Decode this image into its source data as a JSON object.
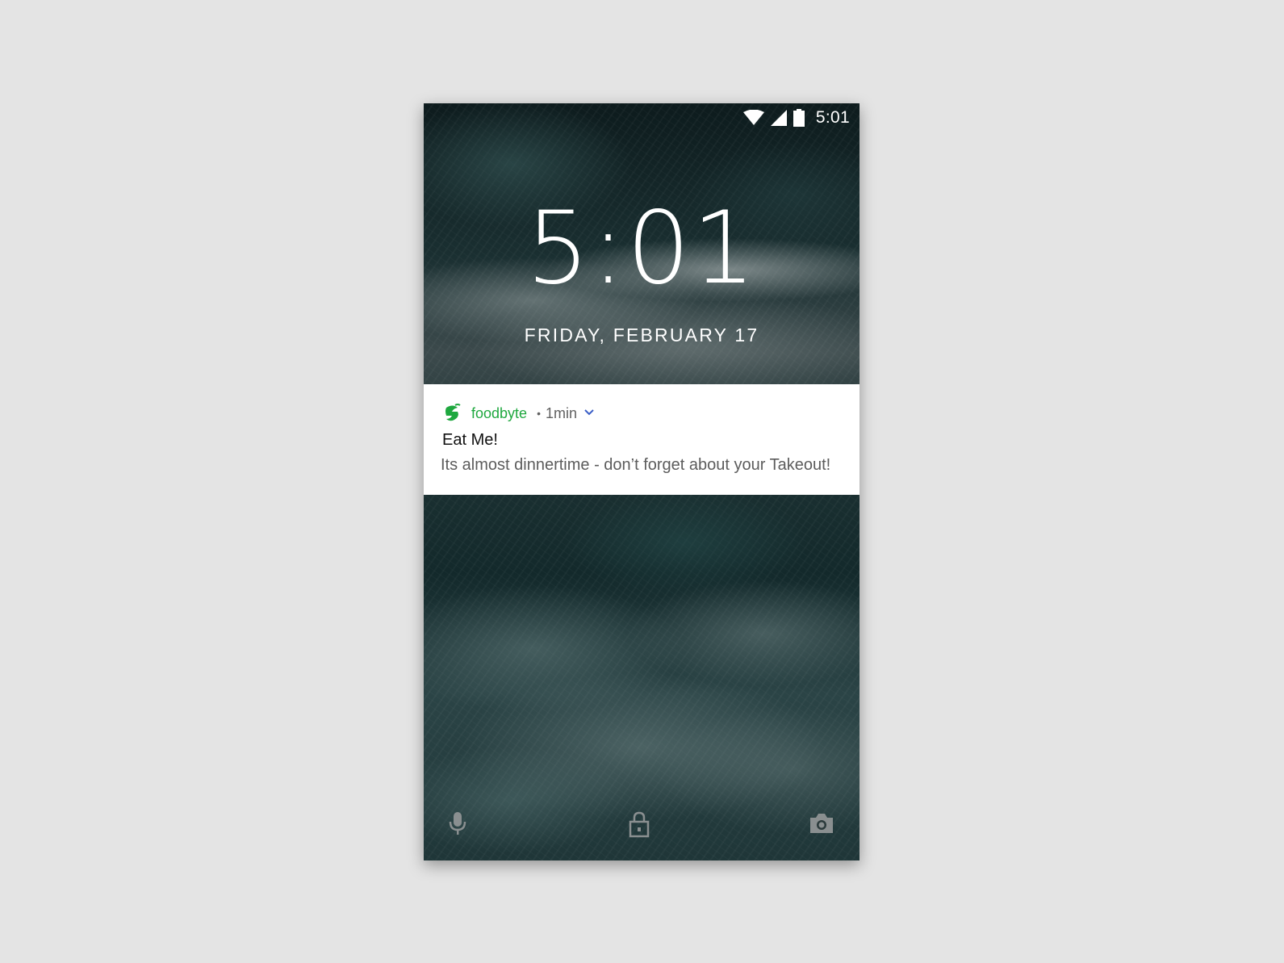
{
  "status_bar": {
    "time": "5:01",
    "icons": [
      "wifi-icon",
      "cellular-signal-icon",
      "battery-icon"
    ]
  },
  "lockscreen": {
    "clock": "5:01",
    "date": "FRIDAY, FEBRUARY 17"
  },
  "notification": {
    "app_name": "foodbyte",
    "separator": "•",
    "time_ago": "1min",
    "title": "Eat Me!",
    "body": "Its almost dinnertime - don’t forget about your Takeout!",
    "app_color": "#1fa83f",
    "icons": [
      "foodbyte-logo-icon",
      "chevron-down-icon"
    ]
  },
  "bottom_actions": {
    "icons": [
      "microphone-icon",
      "lock-icon",
      "camera-icon"
    ]
  }
}
